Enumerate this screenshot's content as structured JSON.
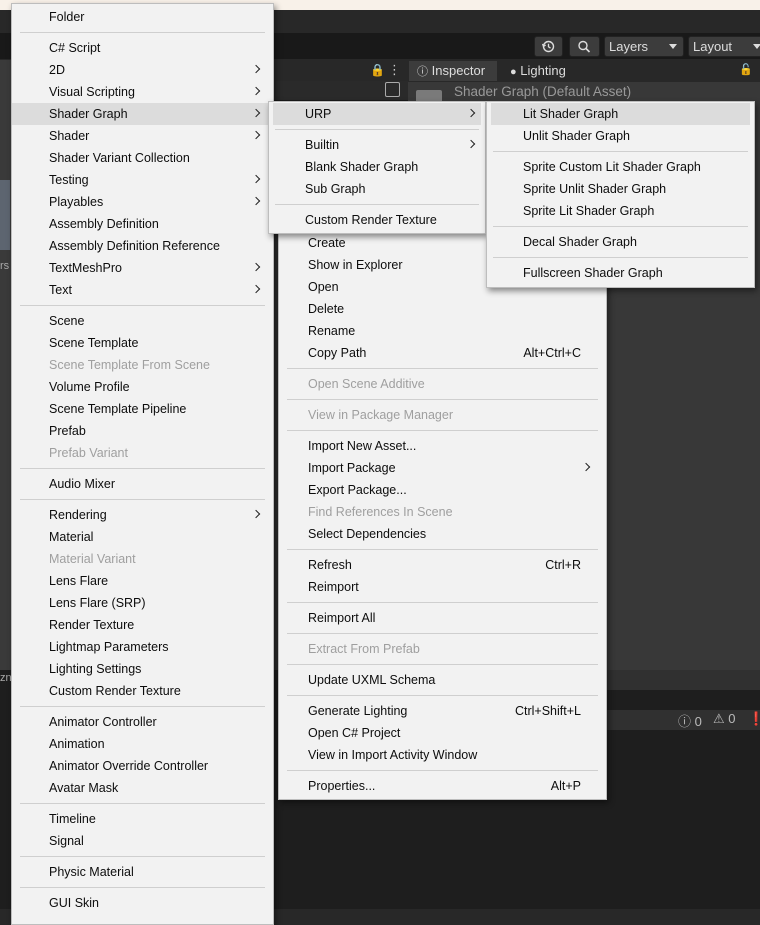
{
  "toolbar": {
    "history_icon": "history-icon",
    "search_icon": "search-icon",
    "layers": "Layers",
    "layout": "Layout"
  },
  "panels": {
    "inspector_tab": "Inspector",
    "lighting_tab": "Lighting",
    "asset_title": "Shader Graph (Default Asset)",
    "console_counts": [
      "0",
      "0"
    ],
    "left_fragments": [
      "rs",
      "zn"
    ]
  },
  "create_menu": {
    "groups": [
      [
        {
          "label": "Folder"
        }
      ],
      [
        {
          "label": "C# Script"
        },
        {
          "label": "2D",
          "submenu": true
        },
        {
          "label": "Visual Scripting",
          "submenu": true
        },
        {
          "label": "Shader Graph",
          "submenu": true,
          "highlighted": true
        },
        {
          "label": "Shader",
          "submenu": true
        },
        {
          "label": "Shader Variant Collection"
        },
        {
          "label": "Testing",
          "submenu": true
        },
        {
          "label": "Playables",
          "submenu": true
        },
        {
          "label": "Assembly Definition"
        },
        {
          "label": "Assembly Definition Reference"
        },
        {
          "label": "TextMeshPro",
          "submenu": true
        },
        {
          "label": "Text",
          "submenu": true
        }
      ],
      [
        {
          "label": "Scene"
        },
        {
          "label": "Scene Template"
        },
        {
          "label": "Scene Template From Scene",
          "disabled": true
        },
        {
          "label": "Volume Profile"
        },
        {
          "label": "Scene Template Pipeline"
        },
        {
          "label": "Prefab"
        },
        {
          "label": "Prefab Variant",
          "disabled": true
        }
      ],
      [
        {
          "label": "Audio Mixer"
        }
      ],
      [
        {
          "label": "Rendering",
          "submenu": true
        },
        {
          "label": "Material"
        },
        {
          "label": "Material Variant",
          "disabled": true
        },
        {
          "label": "Lens Flare"
        },
        {
          "label": "Lens Flare (SRP)"
        },
        {
          "label": "Render Texture"
        },
        {
          "label": "Lightmap Parameters"
        },
        {
          "label": "Lighting Settings"
        },
        {
          "label": "Custom Render Texture"
        }
      ],
      [
        {
          "label": "Animator Controller"
        },
        {
          "label": "Animation"
        },
        {
          "label": "Animator Override Controller"
        },
        {
          "label": "Avatar Mask"
        }
      ],
      [
        {
          "label": "Timeline"
        },
        {
          "label": "Signal"
        }
      ],
      [
        {
          "label": "Physic Material"
        }
      ],
      [
        {
          "label": "GUI Skin"
        }
      ]
    ]
  },
  "context_menu": {
    "groups": [
      [
        {
          "label": "Create"
        },
        {
          "label": "Show in Explorer"
        },
        {
          "label": "Open"
        },
        {
          "label": "Delete"
        },
        {
          "label": "Rename"
        },
        {
          "label": "Copy Path",
          "shortcut": "Alt+Ctrl+C"
        }
      ],
      [
        {
          "label": "Open Scene Additive",
          "disabled": true
        }
      ],
      [
        {
          "label": "View in Package Manager",
          "disabled": true
        }
      ],
      [
        {
          "label": "Import New Asset..."
        },
        {
          "label": "Import Package",
          "submenu": true
        },
        {
          "label": "Export Package..."
        },
        {
          "label": "Find References In Scene",
          "disabled": true
        },
        {
          "label": "Select Dependencies"
        }
      ],
      [
        {
          "label": "Refresh",
          "shortcut": "Ctrl+R"
        },
        {
          "label": "Reimport"
        }
      ],
      [
        {
          "label": "Reimport All"
        }
      ],
      [
        {
          "label": "Extract From Prefab",
          "disabled": true
        }
      ],
      [
        {
          "label": "Update UXML Schema"
        }
      ],
      [
        {
          "label": "Generate Lighting",
          "shortcut": "Ctrl+Shift+L"
        },
        {
          "label": "Open C# Project"
        },
        {
          "label": "View in Import Activity Window"
        }
      ],
      [
        {
          "label": "Properties...",
          "shortcut": "Alt+P"
        }
      ]
    ]
  },
  "shader_graph_menu": {
    "groups": [
      [
        {
          "label": "URP",
          "submenu": true,
          "highlighted": true
        }
      ],
      [
        {
          "label": "Builtin",
          "submenu": true
        },
        {
          "label": "Blank Shader Graph"
        },
        {
          "label": "Sub Graph"
        }
      ],
      [
        {
          "label": "Custom Render Texture"
        }
      ]
    ]
  },
  "urp_menu": {
    "groups": [
      [
        {
          "label": "Lit Shader Graph",
          "highlighted": true
        },
        {
          "label": "Unlit Shader Graph"
        }
      ],
      [
        {
          "label": "Sprite Custom Lit Shader Graph"
        },
        {
          "label": "Sprite Unlit Shader Graph"
        },
        {
          "label": "Sprite Lit Shader Graph"
        }
      ],
      [
        {
          "label": "Decal Shader Graph"
        }
      ],
      [
        {
          "label": "Fullscreen Shader Graph"
        }
      ]
    ]
  }
}
